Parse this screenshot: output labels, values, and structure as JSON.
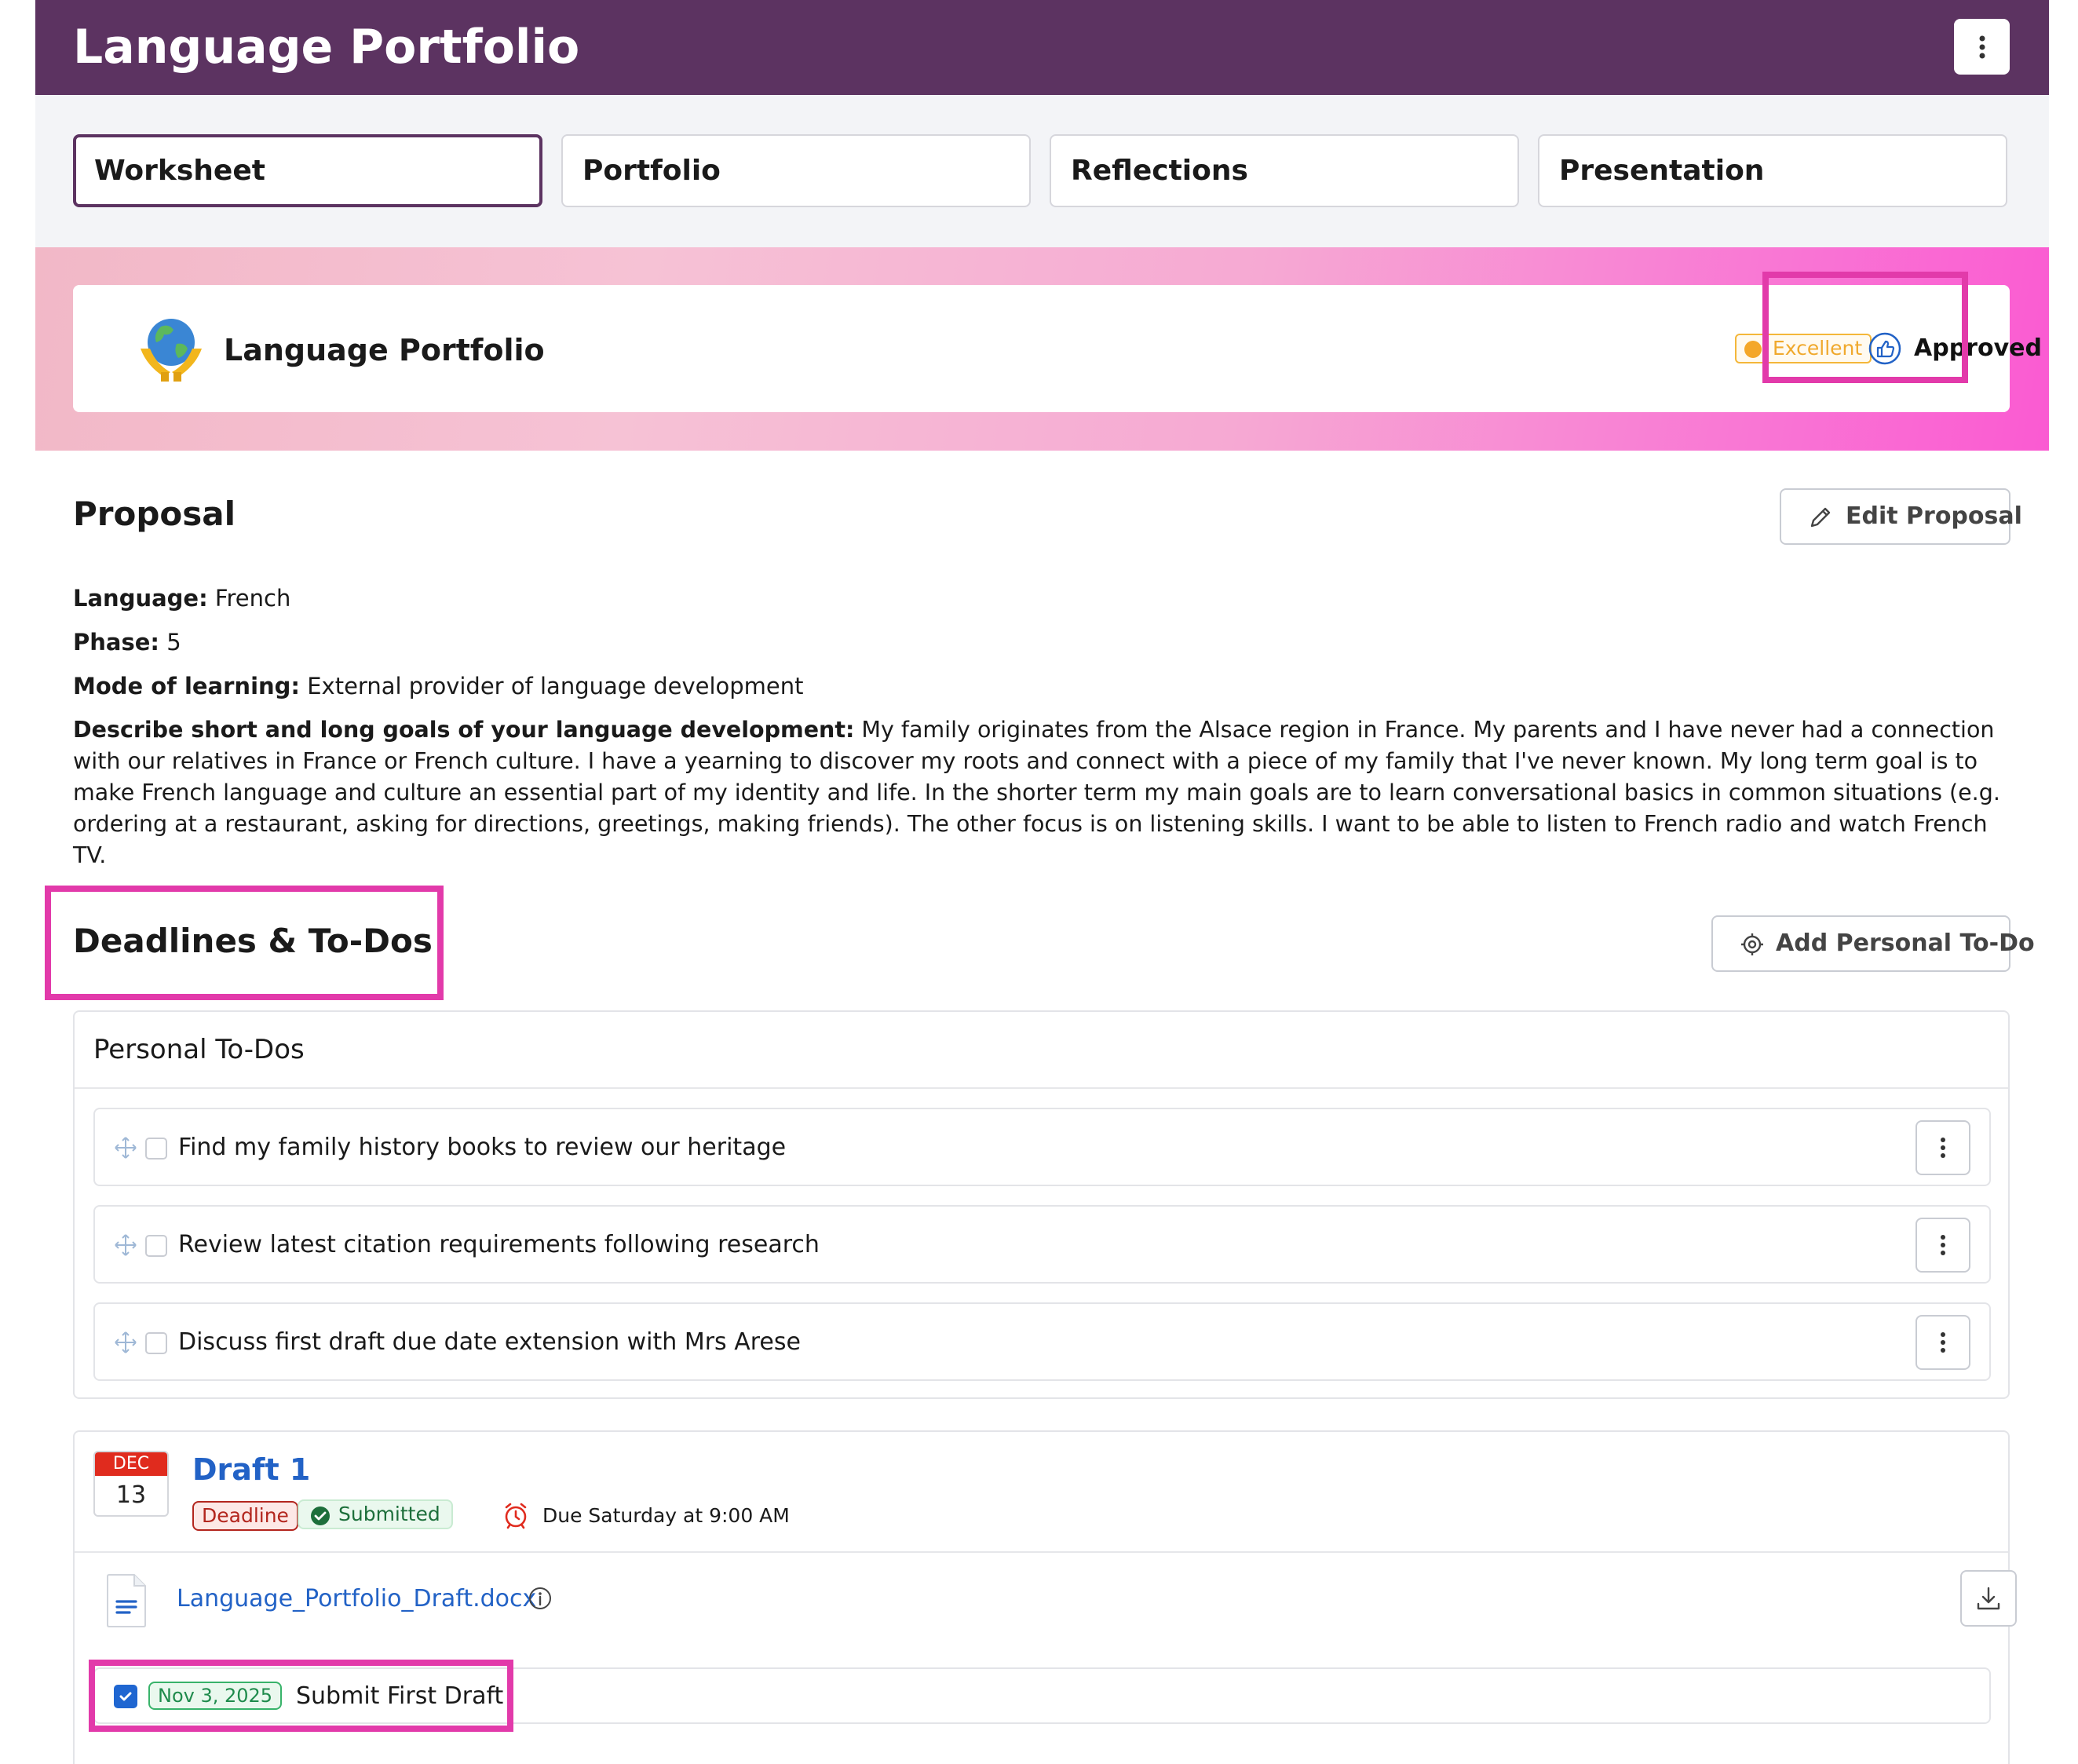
{
  "header": {
    "title": "Language Portfolio",
    "menu_icon": "kebab-menu-icon"
  },
  "tabs": [
    {
      "label": "Worksheet",
      "active": true
    },
    {
      "label": "Portfolio",
      "active": false
    },
    {
      "label": "Reflections",
      "active": false
    },
    {
      "label": "Presentation",
      "active": false
    }
  ],
  "banner": {
    "title": "Language Portfolio",
    "icon": "globe-in-hands-icon",
    "rating_badge": "Excellent",
    "status_icon": "thumbs-up-icon",
    "status": "Approved"
  },
  "proposal": {
    "heading": "Proposal",
    "edit_button": "Edit Proposal",
    "fields": {
      "language_label": "Language:",
      "language_value": "French",
      "phase_label": "Phase:",
      "phase_value": "5",
      "mode_label": "Mode of learning:",
      "mode_value": "External provider of language development",
      "goals_label": "Describe short and long goals of your language development:",
      "goals_value": "My family originates from the Alsace region in France. My parents and I have never had a connection with our relatives in France or French culture. I have a yearning to discover my roots and connect with a piece of my family that I've never known. My long term goal is to make French language and culture an essential part of my identity and life. In the shorter term my main goals are to learn conversational basics in common situations (e.g. ordering at a restaurant, asking for directions, greetings, making friends). The other focus is on listening skills. I want to be able to listen to French radio and watch French TV."
    }
  },
  "deadlines": {
    "heading": "Deadlines & To-Dos",
    "add_button": "Add Personal To-Do",
    "personal_todos": {
      "title": "Personal To-Dos",
      "items": [
        {
          "text": "Find my family history books to review our heritage",
          "checked": false
        },
        {
          "text": "Review latest citation requirements following research",
          "checked": false
        },
        {
          "text": "Discuss first draft due date extension with Mrs Arese",
          "checked": false
        }
      ]
    },
    "draft": {
      "month": "DEC",
      "day": "13",
      "title": "Draft 1",
      "deadline_badge": "Deadline",
      "submitted_badge": "Submitted",
      "due_text": "Due Saturday at 9:00 AM",
      "file_name": "Language_Portfolio_Draft.docx",
      "subtask": {
        "date": "Nov 3, 2025",
        "text": "Submit First Draft",
        "checked": true
      }
    }
  },
  "colors": {
    "header_bg": "#5c3361",
    "highlight": "#e23aaa",
    "link": "#2262c6",
    "excellent": "#f4b73a",
    "deadline": "#b3261e",
    "submitted": "#1d6f3b"
  }
}
